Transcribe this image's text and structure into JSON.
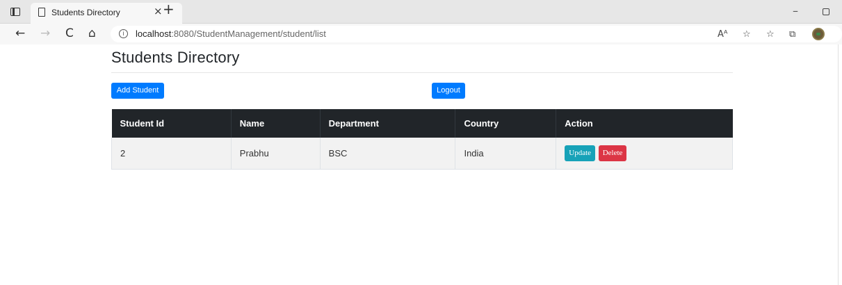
{
  "browser": {
    "tab_title": "Students Directory",
    "tab_close": "×",
    "new_tab": "+",
    "minimize": "–",
    "url_host": "localhost",
    "url_path": ":8080/StudentManagement/student/list",
    "nav": {
      "back": "←",
      "forward": "→",
      "refresh": "C",
      "home": "⌂"
    },
    "toolbar_icons": [
      "read-aloud-icon",
      "add-favorite-icon",
      "favorites-icon",
      "collections-icon",
      "profile-avatar"
    ],
    "read_aloud_label": "Aᴬ"
  },
  "page": {
    "title": "Students Directory",
    "add_button": "Add Student",
    "logout_button": "Logout"
  },
  "table": {
    "headers": [
      "Student Id",
      "Name",
      "Department",
      "Country",
      "Action"
    ],
    "rows": [
      {
        "id": "2",
        "name": "Prabhu",
        "department": "BSC",
        "country": "India",
        "update": "Update",
        "delete": "Delete"
      }
    ]
  },
  "colors": {
    "primary": "#007bff",
    "info": "#17a2b8",
    "danger": "#dc3545",
    "table_header": "#212529",
    "row_bg": "#f2f2f2"
  }
}
